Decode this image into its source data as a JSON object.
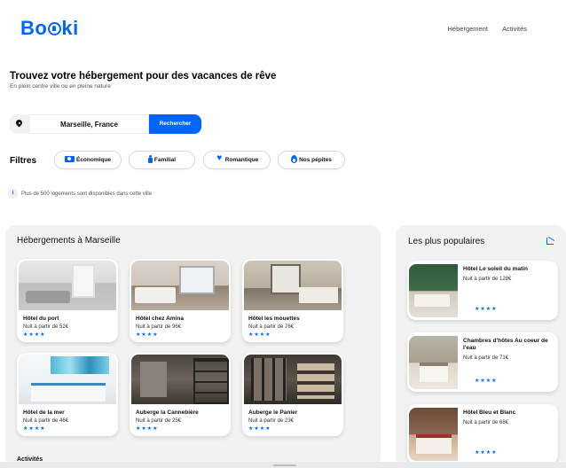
{
  "header": {
    "logo": "Booki",
    "logo_prefix": "Bo",
    "logo_suffix": "ki",
    "nav": [
      "Hébergement",
      "Activités"
    ]
  },
  "hero": {
    "title": "Trouvez votre hébergement pour des vacances de rêve",
    "subtitle": "En plein centre ville ou en pleine nature"
  },
  "search": {
    "value": "Marseille, France",
    "button": "Rechercher",
    "icon": "location-pin-icon"
  },
  "filters": {
    "label": "Filtres",
    "items": [
      {
        "label": "Économique",
        "icon": "money-icon"
      },
      {
        "label": "Familial",
        "icon": "child-icon"
      },
      {
        "label": "Romantique",
        "icon": "heart-icon"
      },
      {
        "label": "Nos pépites",
        "icon": "fire-icon"
      }
    ]
  },
  "info": {
    "icon_text": "i",
    "text": "Plus de 500 logements sont disponibles dans cette ville"
  },
  "hebergements": {
    "title": "Hébergements à Marseille",
    "items": [
      {
        "name": "Hôtel du port",
        "price": "Nuit à partir de 52€",
        "stars": "★★★★",
        "rating": 4
      },
      {
        "name": "Hôtel chez Amina",
        "price": "Nuit à partir de 96€",
        "stars": "★★★★",
        "rating": 4
      },
      {
        "name": "Hôtel les mouettes",
        "price": "Nuit à partir de 76€",
        "stars": "★★★★",
        "rating": 4
      },
      {
        "name": "Hôtel de la mer",
        "price": "Nuit à partir de 46€",
        "stars": "★★★★",
        "rating": 4
      },
      {
        "name": "Auberge la Cannebière",
        "price": "Nuit à partir de 25€",
        "stars": "★★★★",
        "rating": 4
      },
      {
        "name": "Auberge le Panier",
        "price": "Nuit à partir de 23€",
        "stars": "★★★★",
        "rating": 4
      }
    ]
  },
  "populaires": {
    "title": "Les plus populaires",
    "icon": "trend-chart-icon",
    "items": [
      {
        "name": "Hôtel Le soleil du matin",
        "price": "Nuit à partir de 128€",
        "stars": "★★★★",
        "rating": 4
      },
      {
        "name": "Chambres d'hôtes Au coeur de l'eau",
        "price": "Nuit à partir de 71€",
        "stars": "★★★★",
        "rating": 4
      },
      {
        "name": "Hôtel Bleu et Blanc",
        "price": "Nuit à partir de 68€",
        "stars": "★★★★",
        "rating": 4
      }
    ]
  },
  "footer_peek": "Activités",
  "colors": {
    "accent": "#0065FC",
    "panel": "#f2f2f2"
  }
}
